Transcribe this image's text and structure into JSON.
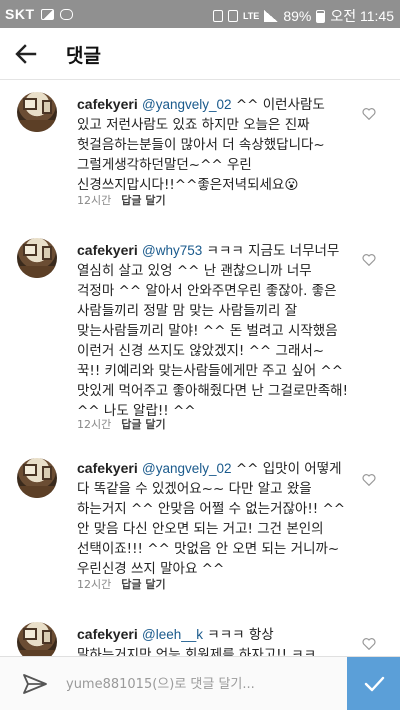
{
  "status_bar": {
    "carrier": "SKT",
    "network": "LTE",
    "battery": "89%",
    "time": "오전 11:45"
  },
  "header": {
    "title": "댓글"
  },
  "comments": [
    {
      "user": "cafekyeri",
      "mention": "@yangvely_02",
      "text": " ^^ 이런사람도 있고 저런사람도 있죠 하지만 오늘은 진짜 헛걸음하는분들이 많아서 더 속상했답니다~ 그럴게생각하던말던~^^ 우린 신경쓰지맙시다!!^^좋은저녁되세요😮",
      "time": "12시간",
      "reply": "답글 달기"
    },
    {
      "user": "cafekyeri",
      "mention": "@why753",
      "text": " ㅋㅋㅋ 지금도 너무너무 열심히 살고 있엉 ^^ 난 괜찮으니까 너무 걱정마 ^^ 알아서 안와주면우린 좋잖아. 좋은 사람들끼리 정말 맘 맞는 사람들끼리 잘 맞는사람들끼리 말야! ^^ 돈 벌려고 시작했음 이런거 신경 쓰지도 않았겠지! ^^ 그래서~ 꾹!! 키예리와 맞는사람들에게만 주고 싶어 ^^ 맛있게 먹어주고 좋아해줬다면 난 그걸로만족해! ^^ 나도 알랍!! ^^",
      "time": "12시간",
      "reply": "답글 달기"
    },
    {
      "user": "cafekyeri",
      "mention": "@yangvely_02",
      "text": " ^^ 입맛이 어떻게 다 똑같을 수 있겠어요~~ 다만 알고 왔을 하는거지 ^^ 안맞음 어쩔 수 없는거잖아!! ^^ 안 맞음 다신 안오면 되는 거고! 그건 본인의 선택이죠!!! ^^ 맛없음 안 오면 되는 거니까~ 우린신경 쓰지 말아요 ^^",
      "time": "12시간",
      "reply": "답글 달기"
    },
    {
      "user": "cafekyeri",
      "mention": "@leeh__k",
      "text": " ㅋㅋㅋ 항상 말하는거지만 언능 회원제를 하자고!! ㅋㅋ 어떻게 하면 잘",
      "time": "",
      "reply": ""
    }
  ],
  "composer": {
    "placeholder": "yume881015(으)로 댓글 달기..."
  },
  "colors": {
    "status_bar": "#909090",
    "mention": "#1a5a8c",
    "send_button": "#5b9fd8"
  },
  "icons": {
    "back": "arrow-left-icon",
    "like": "heart-outline-icon",
    "share": "paper-plane-icon",
    "send": "checkmark-icon"
  }
}
